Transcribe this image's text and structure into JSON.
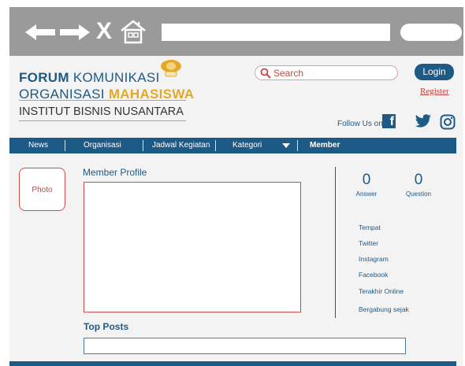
{
  "browser": {
    "icons": [
      "arrow-left-icon",
      "arrow-right-icon",
      "close-icon",
      "home-icon"
    ],
    "close_glyph": "X"
  },
  "header": {
    "logo": {
      "line1_bold": "FORUM",
      "line1_rest": " KOMUNIKASI",
      "line2_rest": "ORGANISASI ",
      "line2_bold": "MAHASISWA",
      "line3": "INSTITUT BISNIS NUSANTARA"
    },
    "search_label": "Search",
    "login_label": "Login",
    "register_label": "Register",
    "follow_label": "Follow Us on",
    "facebook_glyph": "f"
  },
  "menu": {
    "items": [
      "News",
      "Organisasi",
      "Jadwal Kegiatan",
      "Kategori",
      "Member"
    ],
    "active": "Member"
  },
  "profile": {
    "photo_label": "Photo",
    "title": "Member Profile",
    "stats": [
      {
        "value": "0",
        "label": "Answer"
      },
      {
        "value": "0",
        "label": "Question"
      }
    ],
    "info_items": [
      "Tempat",
      "Twitter",
      "Instagram",
      "Facebook",
      "Terakhir Online",
      "Bergabung sejak"
    ]
  },
  "top_posts": {
    "title": "Top Posts"
  },
  "colors": {
    "brand_blue": "#1e5a86",
    "accent_gold": "#e3a929",
    "accent_red": "#d14242",
    "chrome_gray": "#9a9a9a"
  }
}
